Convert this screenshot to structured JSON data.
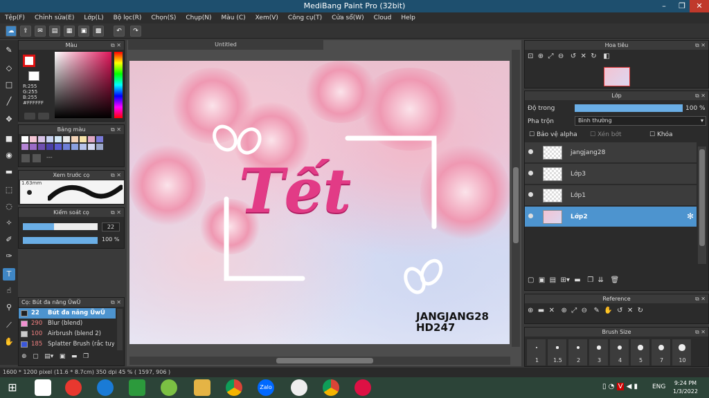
{
  "window": {
    "title": "MediBang Paint Pro (32bit)"
  },
  "menu": [
    "Tệp(F)",
    "Chỉnh sửa(E)",
    "Lớp(L)",
    "Bộ lọc(R)",
    "Chọn(S)",
    "Chụp(N)",
    "Màu (C)",
    "Xem(V)",
    "Công cụ(T)",
    "Cửa sổ(W)",
    "Cloud",
    "Help"
  ],
  "panels": {
    "color": {
      "title": "Màu",
      "r": "R:255",
      "g": "G:255",
      "b": "B:255",
      "hex": "#FFFFFF"
    },
    "palette": {
      "title": "Bảng màu",
      "dash": "---"
    },
    "brush_preview": {
      "title": "Xem trước cọ",
      "size": "1.63mm"
    },
    "brush_control": {
      "title": "Kiểm soát cọ",
      "size": "22",
      "opacity": "100 %",
      "size_frac": 0.42,
      "opacity_frac": 1.0
    },
    "brush_list": {
      "title": "Cọ: Bút đa năng ŬwŬ",
      "items": [
        {
          "num": "22",
          "name": "Bút đa năng ŬwŬ",
          "color": "#222222",
          "selected": true
        },
        {
          "num": "290",
          "name": "Blur (blend)",
          "color": "#f090d0",
          "selected": false
        },
        {
          "num": "100",
          "name": "Airbrush (blend 2)",
          "color": "#cccccc",
          "selected": false
        },
        {
          "num": "185",
          "name": "Splatter Brush (rắc tuyết",
          "color": "#3a56d8",
          "selected": false
        }
      ]
    },
    "navigator": {
      "title": "Hoa tiêu"
    },
    "layer": {
      "title": "Lớp",
      "opacity_label": "Độ trong",
      "opacity_value": "100 %",
      "blend_label": "Pha trộn",
      "blend_value": "Bình thường",
      "protect_alpha": "Bảo vệ alpha",
      "clipping": "Xén bớt",
      "lock": "Khóa",
      "layers": [
        {
          "name": "jangjang28",
          "selected": false
        },
        {
          "name": "Lớp3",
          "selected": false
        },
        {
          "name": "Lớp1",
          "selected": false
        },
        {
          "name": "Lớp2",
          "selected": true
        }
      ]
    },
    "reference": {
      "title": "Reference"
    },
    "brush_size": {
      "title": "Brush Size",
      "sizes": [
        "1",
        "1.5",
        "2",
        "3",
        "4",
        "5",
        "7",
        "10"
      ]
    }
  },
  "document": {
    "tab": "Untitled",
    "title_text": "Tết",
    "signature_line1": "JANGJANG28",
    "signature_line2": "HD247"
  },
  "status": {
    "text": "1600 * 1200 pixel   (11.6 * 8.7cm)   350 dpi   45 %   ( 1597, 906 )"
  },
  "taskbar": {
    "lang": "ENG",
    "time": "9:24 PM",
    "date": "1/3/2022",
    "zalo": "Zalo"
  },
  "colors": {
    "accent": "#4d94cf",
    "title_pink": "#e23b86"
  }
}
